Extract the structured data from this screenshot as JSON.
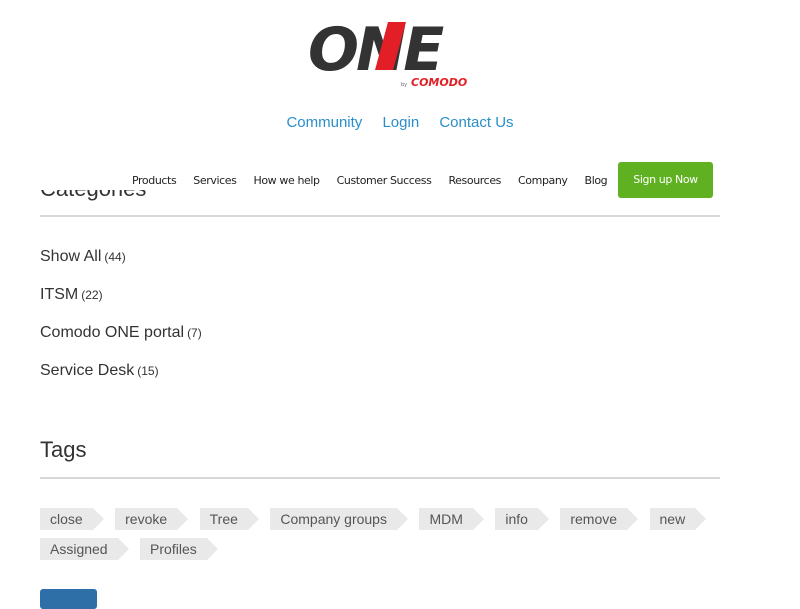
{
  "brand": {
    "logo_text": "ONE",
    "logo_sub": "COMODO",
    "logo_by": "by"
  },
  "top_links": [
    "Community",
    "Login",
    "Contact Us"
  ],
  "main_nav": {
    "items": [
      "Products",
      "Services",
      "How we help",
      "Customer Success",
      "Resources",
      "Company",
      "Blog"
    ],
    "signup_label": "Sign up Now"
  },
  "categories_heading": "Categories",
  "categories": [
    {
      "name": "Show All",
      "count": "(44)"
    },
    {
      "name": "ITSM",
      "count": "(22)"
    },
    {
      "name": "Comodo ONE portal",
      "count": "(7)"
    },
    {
      "name": "Service Desk",
      "count": "(15)"
    }
  ],
  "tags_heading": "Tags",
  "tags": [
    "close",
    "revoke",
    "Tree",
    "Company groups",
    "MDM",
    "info",
    "remove",
    "new",
    "Assigned",
    "Profiles"
  ],
  "colors": {
    "link": "#2a8fc9",
    "signup": "#5fb121",
    "logo_red": "#e21f26",
    "logo_dark": "#333333",
    "tag_bg": "#e9e9e9"
  }
}
